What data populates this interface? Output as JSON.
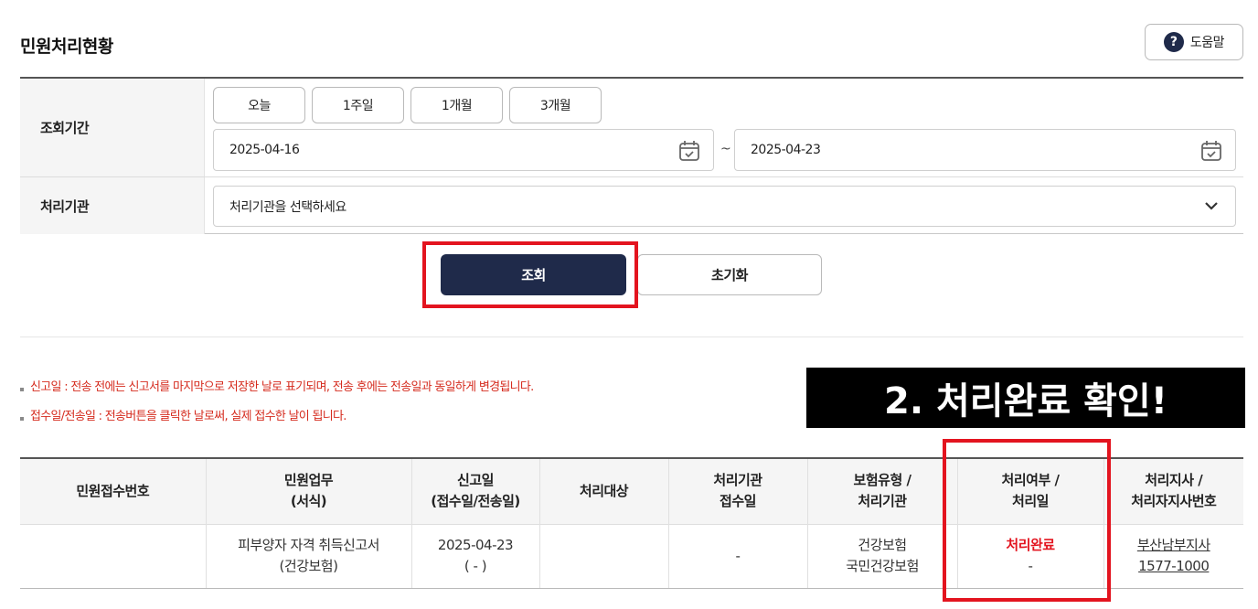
{
  "page": {
    "title": "민원처리현황"
  },
  "help": {
    "icon": "question-icon",
    "glyph": "?",
    "label": "도움말"
  },
  "search": {
    "period_label": "조회기간",
    "period_buttons": [
      "오늘",
      "1주일",
      "1개월",
      "3개월"
    ],
    "start_date": "2025-04-16",
    "end_date": "2025-04-23",
    "range_separator": "~",
    "calendar_icon": "calendar-icon",
    "agency_label": "처리기관",
    "agency_placeholder": "처리기관을 선택하세요",
    "agency_icon": "chevron-down-icon",
    "search_label": "조회",
    "reset_label": "초기화"
  },
  "notices": [
    "신고일 : 전송 전에는 신고서를 마지막으로 저장한 날로 표기되며, 전송 후에는 전송일과 동일하게 변경됩니다.",
    "접수일/전송일 : 전송버튼을 클릭한 날로써, 실제 접수한 날이 됩니다."
  ],
  "annotation": {
    "text": "2. 처리완료 확인!"
  },
  "table": {
    "headers": [
      [
        "민원접수번호"
      ],
      [
        "민원업무",
        "(서식)"
      ],
      [
        "신고일",
        "(접수일/전송일)"
      ],
      [
        "처리대상"
      ],
      [
        "처리기관",
        "접수일"
      ],
      [
        "보험유형 /",
        "처리기관"
      ],
      [
        "처리여부 /",
        "처리일"
      ],
      [
        "처리지사 /",
        "처리자지사번호"
      ]
    ],
    "rows": [
      {
        "receipt_no": "",
        "task": "피부양자 자격 취득신고서",
        "task_form": "(건강보험)",
        "report_date": "2025-04-23",
        "report_date_sub": "( - )",
        "target": "",
        "agency_receipt_date": "-",
        "insurance_type": "건강보험",
        "processing_agency": "국민건강보험",
        "status": "처리완료",
        "processed_date": "-",
        "branch": "부산남부지사",
        "branch_phone": "1577-1000"
      }
    ]
  },
  "colors": {
    "primary_navy": "#1f2a4a",
    "highlight_red": "#e3141f",
    "notice_red": "#d52b1e"
  }
}
